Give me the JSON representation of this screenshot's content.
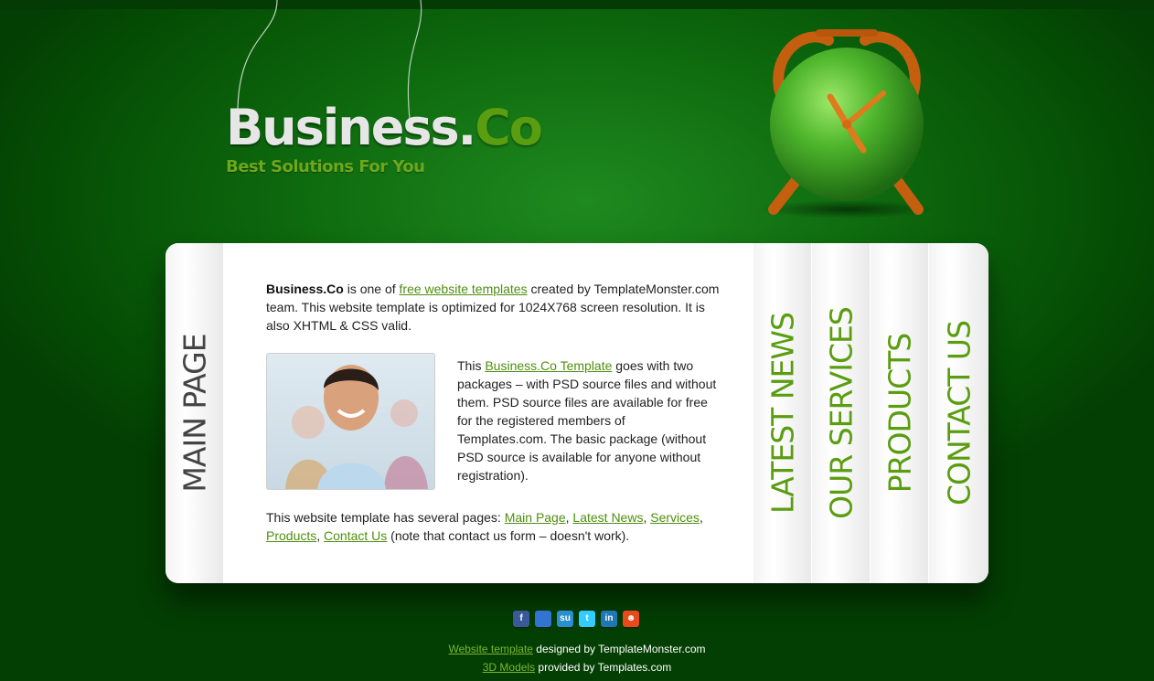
{
  "brand": {
    "name_main": "Business.",
    "name_accent": "Co",
    "tagline": "Best Solutions For You"
  },
  "nav": {
    "main_page": "MAIN PAGE",
    "latest_news": "LATEST NEWS",
    "our_services": "OUR SERVICES",
    "products": "PRODUCTS",
    "contact_us": "CONTACT US"
  },
  "content": {
    "p1": {
      "bold": "Business.Co",
      "text1": " is one of ",
      "link": "free website templates",
      "text2": " created by TemplateMonster.com team. This website template is optimized for 1024X768 screen resolution. It is also XHTML & CSS valid."
    },
    "p2": {
      "text1": "This ",
      "link": "Business.Co Template",
      "text2": " goes with two packages – with PSD source files and without them. PSD source files are available for free for the registered members of Templates.com. The basic package (without PSD source is available for anyone without registration)."
    },
    "p3": {
      "text1": "This website template has several pages: ",
      "link_main": "Main Page",
      "sep1": ", ",
      "link_news": "Latest News",
      "sep2": ", ",
      "link_services": "Services",
      "sep3": ", ",
      "link_products": "Products",
      "sep4": ", ",
      "link_contact": "Contact Us",
      "text2": " (note that contact us form – doesn't work)."
    }
  },
  "social": [
    {
      "icon": "facebook-icon",
      "glyph": "f",
      "color": "#3b5998"
    },
    {
      "icon": "delicious-icon",
      "glyph": "",
      "color": "#3274d1"
    },
    {
      "icon": "stumbleupon-icon",
      "glyph": "su",
      "color": "#2a8fd0"
    },
    {
      "icon": "twitter-icon",
      "glyph": "t",
      "color": "#33ccff"
    },
    {
      "icon": "linkedin-icon",
      "glyph": "in",
      "color": "#1f77b4"
    },
    {
      "icon": "reddit-icon",
      "glyph": "☻",
      "color": "#e84a1c"
    }
  ],
  "footer": {
    "line1_link": "Website template",
    "line1_text": " designed by TemplateMonster.com",
    "line2_link": "3D Models",
    "line2_text": " provided by Templates.com"
  }
}
